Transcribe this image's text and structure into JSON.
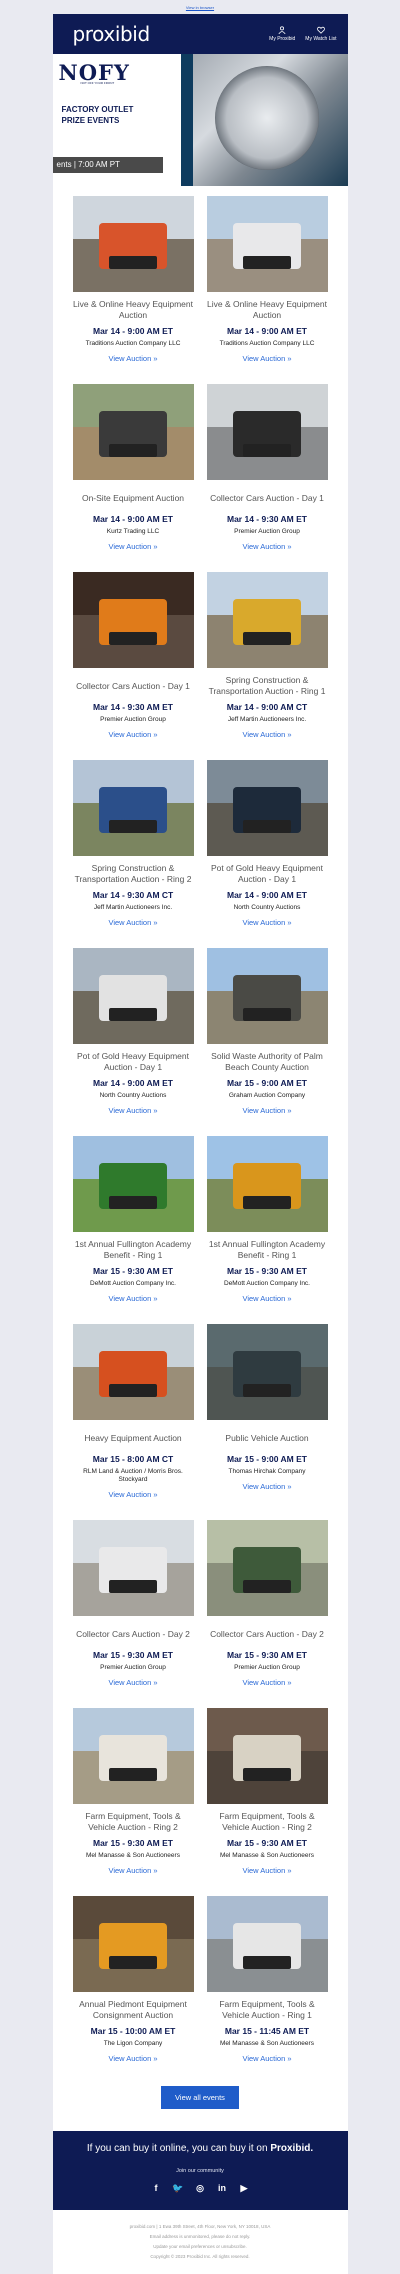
{
  "topbar": {
    "browser_link": "View in browser"
  },
  "header": {
    "logo": "proxibid",
    "links": [
      {
        "label": "My Proxibid",
        "icon": "user-icon"
      },
      {
        "label": "My Watch List",
        "icon": "heart-icon"
      }
    ]
  },
  "hero": {
    "brand": "NOFY",
    "brand_sub": "NOT OFF YOUR FRONT",
    "title_line1": "FACTORY OUTLET",
    "title_line2": "PRIZE EVENTS",
    "pill": "ents  |  7:00 AM PT"
  },
  "auctions": [
    {
      "title": "Live & Online Heavy Equipment Auction",
      "date": "Mar 14 - 9:00 AM ET",
      "house": "Traditions Auction Company LLC",
      "link": "View Auction »",
      "sky": "#cfd6dd",
      "ground": "#7a7164",
      "obj": "#d8542b"
    },
    {
      "title": "Live & Online Heavy Equipment Auction",
      "date": "Mar 14 - 9:00 AM ET",
      "house": "Traditions Auction Company LLC",
      "link": "View Auction »",
      "sky": "#b9cde0",
      "ground": "#9a8f80",
      "obj": "#e8e8ea"
    },
    {
      "title": "On-Site Equipment Auction",
      "date": "Mar 14 - 9:00 AM ET",
      "house": "Kurtz Trading LLC",
      "link": "View Auction »",
      "sky": "#8fa07a",
      "ground": "#a38c6a",
      "obj": "#3a3a3a"
    },
    {
      "title": "Collector Cars Auction - Day 1",
      "date": "Mar 14 - 9:30 AM ET",
      "house": "Premier Auction Group",
      "link": "View Auction »",
      "sky": "#cfd3d6",
      "ground": "#8a8c8e",
      "obj": "#2a2a2a"
    },
    {
      "title": "Collector Cars Auction - Day 1",
      "date": "Mar 14 - 9:30 AM ET",
      "house": "Premier Auction Group",
      "link": "View Auction »",
      "sky": "#3a2a22",
      "ground": "#5a4a40",
      "obj": "#e07b1a"
    },
    {
      "title": "Spring Construction & Transportation Auction - Ring 1",
      "date": "Mar 14 - 9:00 AM CT",
      "house": "Jeff Martin Auctioneers Inc.",
      "link": "View Auction »",
      "sky": "#c2d2e2",
      "ground": "#8d8370",
      "obj": "#d9a92c"
    },
    {
      "title": "Spring Construction & Transportation Auction - Ring 2",
      "date": "Mar 14 - 9:30 AM CT",
      "house": "Jeff Martin Auctioneers Inc.",
      "link": "View Auction »",
      "sky": "#b4c4d6",
      "ground": "#7b8560",
      "obj": "#2b4f8a"
    },
    {
      "title": "Pot of Gold Heavy Equipment Auction - Day 1",
      "date": "Mar 14 - 9:00 AM ET",
      "house": "North Country Auctions",
      "link": "View Auction »",
      "sky": "#7d8b97",
      "ground": "#5d5a52",
      "obj": "#1d2a3a"
    },
    {
      "title": "Pot of Gold Heavy Equipment Auction - Day 1",
      "date": "Mar 14 - 9:00 AM ET",
      "house": "North Country Auctions",
      "link": "View Auction »",
      "sky": "#aab6c2",
      "ground": "#6f6a5e",
      "obj": "#e2e2e2"
    },
    {
      "title": "Solid Waste Authority of Palm Beach County Auction",
      "date": "Mar 15 - 9:00 AM ET",
      "house": "Graham Auction Company",
      "link": "View Auction »",
      "sky": "#9fc0e2",
      "ground": "#8c8572",
      "obj": "#4a4a45"
    },
    {
      "title": "1st Annual Fullington Academy Benefit - Ring 1",
      "date": "Mar 15 - 9:30 AM ET",
      "house": "DeMott Auction Company Inc.",
      "link": "View Auction »",
      "sky": "#9fbfe0",
      "ground": "#6f9a4c",
      "obj": "#2f7a2c"
    },
    {
      "title": "1st Annual Fullington Academy Benefit - Ring 1",
      "date": "Mar 15 - 9:30 AM ET",
      "house": "DeMott Auction Company Inc.",
      "link": "View Auction »",
      "sky": "#9ec2e6",
      "ground": "#7c8d5a",
      "obj": "#d9961c"
    },
    {
      "title": "Heavy Equipment Auction",
      "date": "Mar 15 - 8:00 AM CT",
      "house": "RLM Land & Auction / Morris Bros. Stockyard",
      "link": "View Auction »",
      "sky": "#c9d2d8",
      "ground": "#9a8e78",
      "obj": "#d6501f"
    },
    {
      "title": "Public Vehicle Auction",
      "date": "Mar 15 - 9:00 AM ET",
      "house": "Thomas Hirchak Company",
      "link": "View Auction »",
      "sky": "#5a6a6e",
      "ground": "#4f5552",
      "obj": "#2f3b40"
    },
    {
      "title": "Collector Cars Auction - Day 2",
      "date": "Mar 15 - 9:30 AM ET",
      "house": "Premier Auction Group",
      "link": "View Auction »",
      "sky": "#d8dde2",
      "ground": "#a6a39c",
      "obj": "#e9e9ea"
    },
    {
      "title": "Collector Cars Auction - Day 2",
      "date": "Mar 15 - 9:30 AM ET",
      "house": "Premier Auction Group",
      "link": "View Auction »",
      "sky": "#b7bfa6",
      "ground": "#8a8f7c",
      "obj": "#3e5a3a"
    },
    {
      "title": "Farm Equipment, Tools & Vehicle Auction - Ring 2",
      "date": "Mar 15 - 9:30 AM ET",
      "house": "Mel Manasse & Son Auctioneers",
      "link": "View Auction »",
      "sky": "#b6c9dc",
      "ground": "#a59c86",
      "obj": "#e8e4dc"
    },
    {
      "title": "Farm Equipment, Tools & Vehicle Auction - Ring 2",
      "date": "Mar 15 - 9:30 AM ET",
      "house": "Mel Manasse & Son Auctioneers",
      "link": "View Auction »",
      "sky": "#6d5a4c",
      "ground": "#4e433a",
      "obj": "#d8d2c4"
    },
    {
      "title": "Annual Piedmont Equipment Consignment Auction",
      "date": "Mar 15 - 10:00 AM ET",
      "house": "The Ligon Company",
      "link": "View Auction »",
      "sky": "#5a4a3a",
      "ground": "#7a6a52",
      "obj": "#e49a22"
    },
    {
      "title": "Farm Equipment, Tools & Vehicle Auction - Ring 1",
      "date": "Mar 15 - 11:45 AM ET",
      "house": "Mel Manasse & Son Auctioneers",
      "link": "View Auction »",
      "sky": "#aabbd0",
      "ground": "#8a8f92",
      "obj": "#e6e6e6"
    }
  ],
  "view_all": "View all events",
  "footer": {
    "tagline_prefix": "If you can buy it online, you can buy it on ",
    "tagline_brand": "Proxibid.",
    "community": "Join our community",
    "socials": [
      {
        "icon": "facebook-icon",
        "glyph": "f"
      },
      {
        "icon": "twitter-icon",
        "glyph": "🐦"
      },
      {
        "icon": "instagram-icon",
        "glyph": "◎"
      },
      {
        "icon": "linkedin-icon",
        "glyph": "in"
      },
      {
        "icon": "youtube-icon",
        "glyph": "▶"
      }
    ],
    "legal_line1": "proxibid.com | 1 Ewa 39th Street, 4th Floor, New York, NY 10018, USA",
    "legal_line2": "Email address is unmonitored, please do not reply.",
    "legal_line3": "Update your email preferences or unsubscribe.",
    "legal_line4": "Copyright © 2023 Proxibid Inc. All rights reserved."
  }
}
